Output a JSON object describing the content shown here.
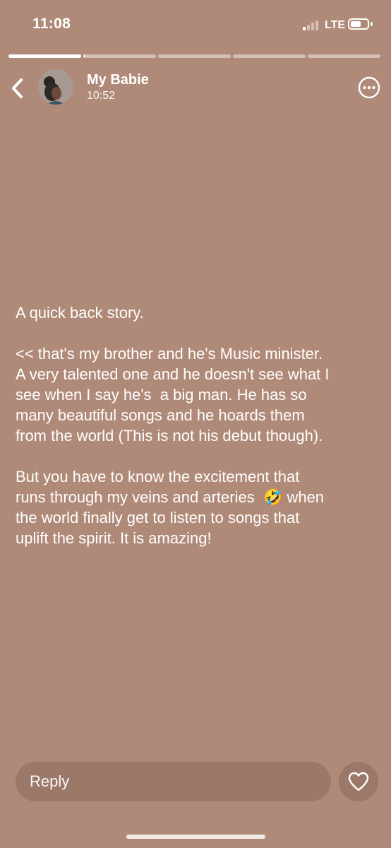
{
  "status_bar": {
    "time": "11:08",
    "network": "LTE",
    "signal_bars_active": 1,
    "signal_bars_total": 4
  },
  "progress": {
    "segments_total": 5,
    "segments_fill": [
      1.0,
      0.02,
      0.0,
      0.0,
      0.0
    ]
  },
  "header": {
    "name": "My Babie",
    "time": "10:52",
    "back_icon": "chevron-left-icon",
    "more_icon": "more-icon"
  },
  "story": {
    "paragraphs": [
      "A quick back story.",
      "<< that's my brother and he's Music minister.\nA very talented one and he doesn't see what I\nsee when I say he's  a big man. He has so\nmany beautiful songs and he hoards them\nfrom the world (This is not his debut though).",
      "But you have to know the excitement that\nruns through my veins and arteries  🤣 when\nthe world finally get to listen to songs that\nuplift the spirit. It is amazing!"
    ]
  },
  "reply": {
    "placeholder": "Reply",
    "like_icon": "heart-icon"
  },
  "colors": {
    "background": "#b08a78",
    "input_background": "#9c7869"
  }
}
